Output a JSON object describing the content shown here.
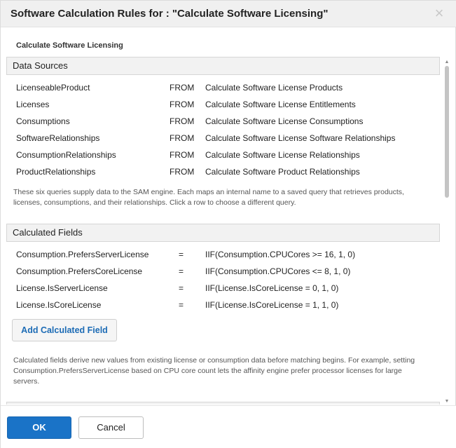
{
  "dialog": {
    "title": "Software Calculation Rules for : \"Calculate Software Licensing\"",
    "close_glyph": "×",
    "close_icon": "close-icon"
  },
  "content": {
    "heading": "Calculate Software Licensing"
  },
  "data_sources": {
    "header": "Data Sources",
    "rows": [
      {
        "name": "LicenseableProduct",
        "keyword": "FROM",
        "query": "Calculate Software License Products"
      },
      {
        "name": "Licenses",
        "keyword": "FROM",
        "query": "Calculate Software License Entitlements"
      },
      {
        "name": "Consumptions",
        "keyword": "FROM",
        "query": "Calculate Software License Consumptions"
      },
      {
        "name": "SoftwareRelationships",
        "keyword": "FROM",
        "query": "Calculate Software License Software Relationships"
      },
      {
        "name": "ConsumptionRelationships",
        "keyword": "FROM",
        "query": "Calculate Software License Relationships"
      },
      {
        "name": "ProductRelationships",
        "keyword": "FROM",
        "query": "Calculate Software Product Relationships"
      }
    ],
    "note": "These six queries supply data to the SAM engine. Each maps an internal name to a saved query that retrieves products, licenses, consumptions, and their relationships. Click a row to choose a different query."
  },
  "calculated_fields": {
    "header": "Calculated Fields",
    "rows": [
      {
        "name": "Consumption.PrefersServerLicense",
        "op": "=",
        "expr": "IIF(Consumption.CPUCores >= 16, 1, 0)"
      },
      {
        "name": "Consumption.PrefersCoreLicense",
        "op": "=",
        "expr": "IIF(Consumption.CPUCores <= 8, 1, 0)"
      },
      {
        "name": "License.IsServerLicense",
        "op": "=",
        "expr": "IIF(License.IsCoreLicense = 0, 1, 0)"
      },
      {
        "name": "License.IsCoreLicense",
        "op": "=",
        "expr": "IIF(License.IsCoreLicense = 1, 1, 0)"
      }
    ],
    "add_button": "Add Calculated Field",
    "note": "Calculated fields derive new values from existing license or consumption data before matching begins. For example, setting Consumption.PrefersServerLicense based on CPU core count lets the affinity engine prefer processor licenses for large servers."
  },
  "footer": {
    "ok": "OK",
    "cancel": "Cancel"
  },
  "colors": {
    "primary": "#1a73c7",
    "link": "#1c6bb5",
    "header_bg": "#f2f2f2",
    "titlebar_bg": "#f0f0f0"
  }
}
